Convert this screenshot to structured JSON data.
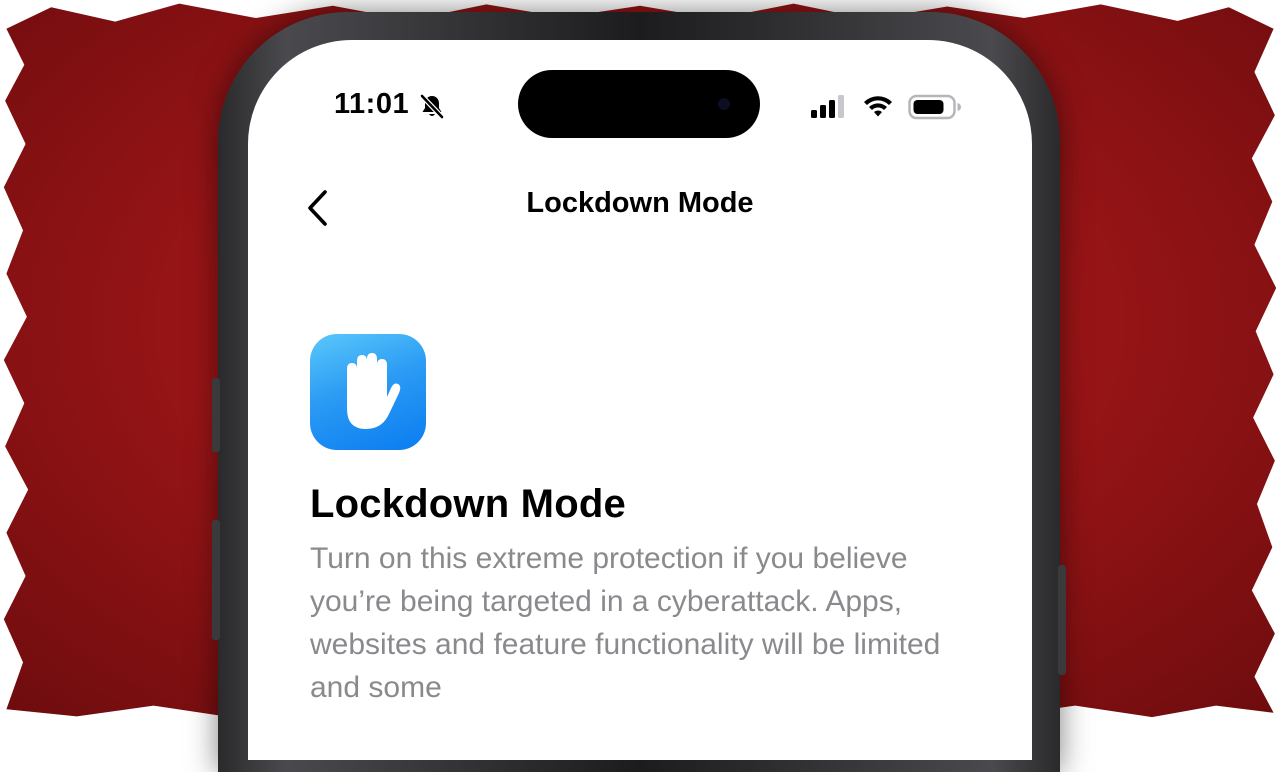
{
  "status_bar": {
    "time": "11:01",
    "bell_icon": "bell-slash-icon",
    "signal_icon": "cellular-signal-icon",
    "wifi_icon": "wifi-icon",
    "battery_icon": "battery-icon"
  },
  "nav": {
    "back_icon": "chevron-left-icon",
    "title": "Lockdown Mode"
  },
  "content": {
    "icon": "raised-hand-icon",
    "icon_color": "#1a8cf2",
    "heading": "Lockdown Mode",
    "description": "Turn on this extreme protection if you believe you’re being targeted in a cyberattack. Apps, websites and feature functionality will be limited and some"
  },
  "colors": {
    "backdrop": "#a3181a",
    "description_text": "#8a8a8e"
  }
}
